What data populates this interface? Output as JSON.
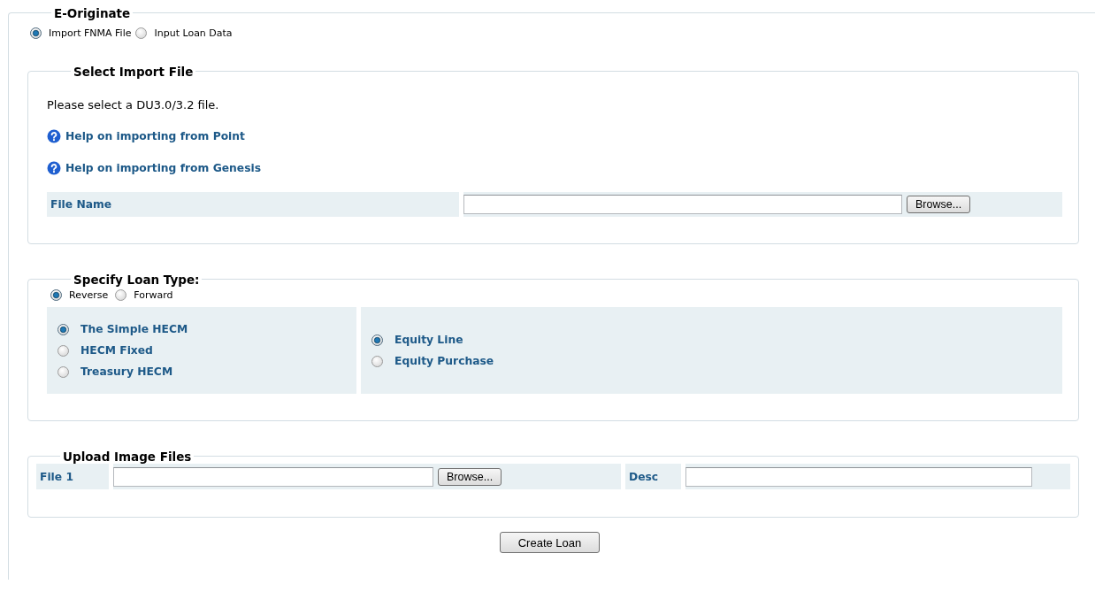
{
  "section": {
    "title": "E-Originate"
  },
  "mode_options": [
    {
      "label": "Import FNMA File",
      "selected": true
    },
    {
      "label": "Input Loan Data",
      "selected": false
    }
  ],
  "import_panel": {
    "title": "Select Import File",
    "instruction": "Please select a DU3.0/3.2 file.",
    "help_links": [
      "Help on importing from Point",
      "Help on importing from Genesis"
    ],
    "file_name": {
      "label": "File Name",
      "button": "Browse..."
    }
  },
  "loan_type_panel": {
    "title": "Specify Loan Type:",
    "direction_options": [
      {
        "label": "Reverse",
        "selected": true
      },
      {
        "label": "Forward",
        "selected": false
      }
    ],
    "program_options": [
      {
        "label": "The Simple HECM",
        "selected": true
      },
      {
        "label": "HECM Fixed",
        "selected": false
      },
      {
        "label": "Treasury HECM",
        "selected": false
      }
    ],
    "draw_options": [
      {
        "label": "Equity Line",
        "selected": true
      },
      {
        "label": "Equity Purchase",
        "selected": false
      }
    ]
  },
  "upload_panel": {
    "title": "Upload Image Files",
    "rows": [
      {
        "file_label": "File 1",
        "button": "Browse...",
        "desc_label": "Desc"
      }
    ]
  },
  "submit_button": "Create Loan"
}
